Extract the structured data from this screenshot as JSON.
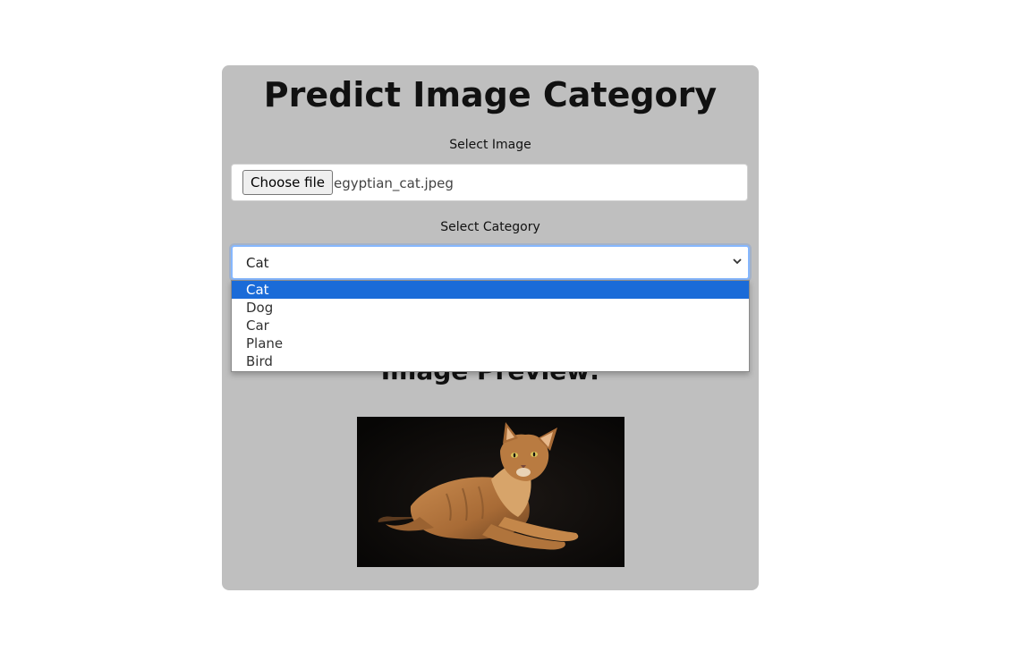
{
  "page": {
    "title": "Predict Image Category"
  },
  "image_input": {
    "label": "Select Image",
    "button_label": "Choose file",
    "file_name": "egyptian_cat.jpeg"
  },
  "category_select": {
    "label": "Select Category",
    "selected": "Cat",
    "options": [
      "Cat",
      "Dog",
      "Car",
      "Plane",
      "Bird"
    ]
  },
  "preview": {
    "title": "Image Preview:"
  },
  "colors": {
    "card_background": "#bfbfbf",
    "selected_option": "#1a6bd8",
    "select_focus_border": "#86b7fe"
  }
}
